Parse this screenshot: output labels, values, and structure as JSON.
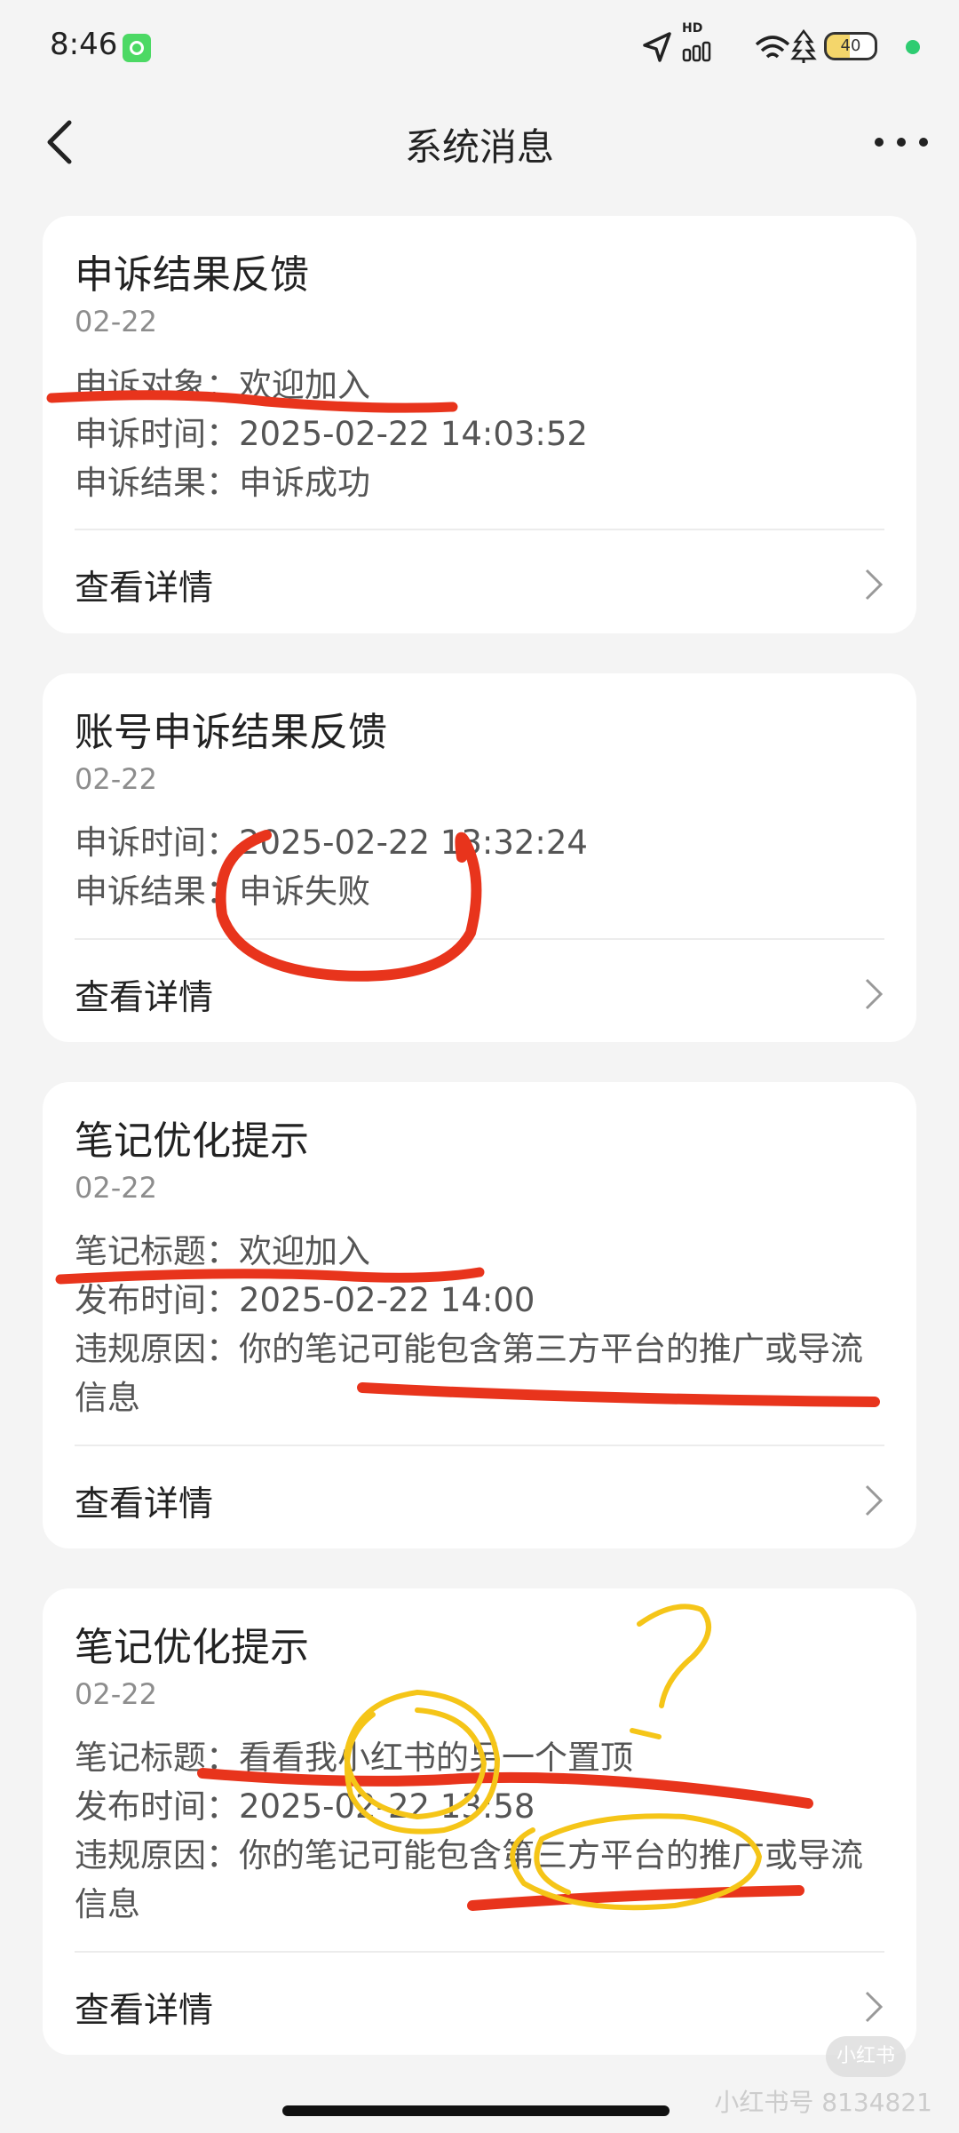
{
  "status_bar": {
    "time": "8:46",
    "battery": "40",
    "signal_label": "HD"
  },
  "nav": {
    "title": "系统消息"
  },
  "cards": [
    {
      "title": "申诉结果反馈",
      "date": "02-22",
      "fields": [
        {
          "label": "申诉对象：",
          "value": "欢迎加入"
        },
        {
          "label": "申诉时间：",
          "value": "2025-02-22 14:03:52"
        },
        {
          "label": "申诉结果：",
          "value": "申诉成功"
        }
      ],
      "details_label": "查看详情"
    },
    {
      "title": "账号申诉结果反馈",
      "date": "02-22",
      "fields": [
        {
          "label": "申诉时间：",
          "value": "2025-02-22 13:32:24"
        },
        {
          "label": "申诉结果：",
          "value": "申诉失败"
        }
      ],
      "details_label": "查看详情"
    },
    {
      "title": "笔记优化提示",
      "date": "02-22",
      "fields": [
        {
          "label": "笔记标题：",
          "value": "欢迎加入"
        },
        {
          "label": "发布时间：",
          "value": "2025-02-22 14:00"
        },
        {
          "label": "违规原因：",
          "value": "你的笔记可能包含第三方平台的推广或导流信息"
        }
      ],
      "details_label": "查看详情"
    },
    {
      "title": "笔记优化提示",
      "date": "02-22",
      "fields": [
        {
          "label": "笔记标题：",
          "value": "看看我小红书的另一个置顶"
        },
        {
          "label": "发布时间：",
          "value": "2025-02-22 13:58"
        },
        {
          "label": "违规原因：",
          "value": "你的笔记可能包含第三方平台的推广或导流信息"
        }
      ],
      "details_label": "查看详情"
    }
  ],
  "watermark": {
    "logo": "小红书",
    "text": "小红书号 8134821"
  },
  "colors": {
    "page_bg": "#f4f4f4",
    "card_bg": "#ffffff",
    "annotation_red": "#e8341c",
    "annotation_yellow": "#f5c518"
  }
}
